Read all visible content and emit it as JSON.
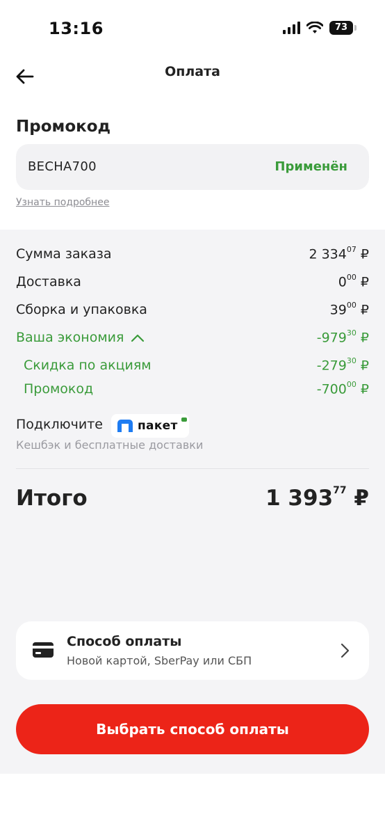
{
  "status_bar": {
    "time": "13:16",
    "battery": "73"
  },
  "header": {
    "title": "Оплата"
  },
  "promo": {
    "heading": "Промокод",
    "code": "ВЕСНА700",
    "status": "Применён",
    "learn_more": "Узнать подробнее"
  },
  "summary": {
    "rows": [
      {
        "label": "Сумма заказа",
        "int": "2 334",
        "frac": "07",
        "cur": "₽"
      },
      {
        "label": "Доставка",
        "int": "0",
        "frac": "00",
        "cur": "₽"
      },
      {
        "label": "Сборка и упаковка",
        "int": "39",
        "frac": "00",
        "cur": "₽"
      }
    ],
    "savings": {
      "label": "Ваша экономия",
      "int": "-979",
      "frac": "30",
      "cur": "₽"
    },
    "savings_items": [
      {
        "label": "Скидка по акциям",
        "int": "-279",
        "frac": "30",
        "cur": "₽"
      },
      {
        "label": "Промокод",
        "int": "-700",
        "frac": "00",
        "cur": "₽"
      }
    ]
  },
  "paket": {
    "connect_label": "Подключите",
    "brand": "пакет",
    "subtitle": "Кешбэк и бесплатные доставки"
  },
  "total": {
    "label": "Итого",
    "int": "1 393",
    "frac": "77",
    "cur": "₽"
  },
  "payment": {
    "title": "Способ оплаты",
    "subtitle": "Новой картой, SberPay или СБП"
  },
  "cta": {
    "label": "Выбрать способ оплаты"
  },
  "colors": {
    "accent_red": "#ec2418",
    "success_green": "#3a9b3a",
    "paket_blue": "#1e7cf2"
  }
}
